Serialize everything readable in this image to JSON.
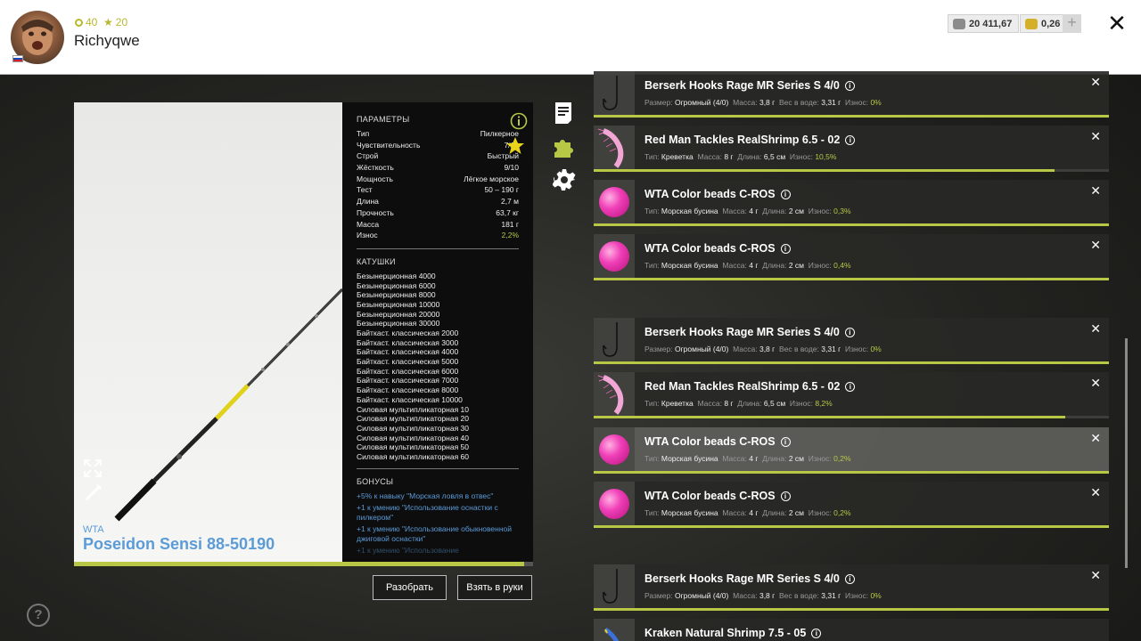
{
  "player": {
    "name": "Richyqwe",
    "level": "40",
    "rank": "20"
  },
  "currency": {
    "silver": "20 411,67",
    "gold": "0,26",
    "add": "+"
  },
  "close": "✕",
  "rod": {
    "brand": "WTA",
    "name": "Poseidon Sensi 88-50190",
    "wear_fraction": 0.98
  },
  "params": {
    "title": "ПАРАМЕТРЫ",
    "rows": [
      {
        "label": "Тип",
        "value": "Пилкерное"
      },
      {
        "label": "Чувствительность",
        "value": "7/10"
      },
      {
        "label": "Строй",
        "value": "Быстрый"
      },
      {
        "label": "Жёсткость",
        "value": "9/10"
      },
      {
        "label": "Мощность",
        "value": "Лёгкое морское"
      },
      {
        "label": "Тест",
        "value": "50 – 190 г"
      },
      {
        "label": "Длина",
        "value": "2,7 м"
      },
      {
        "label": "Прочность",
        "value": "63,7 кг"
      },
      {
        "label": "Масса",
        "value": "181 г"
      },
      {
        "label": "Износ",
        "value": "2,2%"
      }
    ],
    "reels_title": "КАТУШКИ",
    "reels": [
      "Безынерционная 4000",
      "Безынерционная 6000",
      "Безынерционная 8000",
      "Безынерционная 10000",
      "Безынерционная 20000",
      "Безынерционная 30000",
      "Байткаст. классическая 2000",
      "Байткаст. классическая 3000",
      "Байткаст. классическая 4000",
      "Байткаст. классическая 5000",
      "Байткаст. классическая 6000",
      "Байткаст. классическая 7000",
      "Байткаст. классическая 8000",
      "Байткаст. классическая 10000",
      "Силовая мультипликаторная 10",
      "Силовая мультипликаторная 20",
      "Силовая мультипликаторная 30",
      "Силовая мультипликаторная 40",
      "Силовая мультипликаторная 50",
      "Силовая мультипликаторная 60"
    ],
    "bonus_title": "БОНУСЫ",
    "bonuses": [
      "+5% к навыку \"Морская ловля в отвес\"",
      "+1 к умению \"Использование оснастки с пилкером\"",
      "+1 к умению \"Использование обыкновенной джиговой оснастки\"",
      "+1 к умению \"Использование"
    ]
  },
  "buttons": {
    "disassemble": "Разобрать",
    "take": "Взять в руки"
  },
  "labels": {
    "size": "Размер:",
    "mass": "Масса:",
    "weight_water": "Вес в воде:",
    "wear": "Износ:",
    "type": "Тип:",
    "length": "Длина:"
  },
  "items": [
    {
      "kind": "hook",
      "title": "Berserk Hooks Rage MR Series S 4/0",
      "size": "Огромный (4/0)",
      "mass": "3,8 г",
      "weight_water": "3,31 г",
      "wear": "0%",
      "bar": 1.0
    },
    {
      "kind": "shrimp",
      "title": "Red Man Tackles RealShrimp 6.5 - 02",
      "type": "Креветка",
      "mass": "8 г",
      "length": "6,5 см",
      "wear": "10,5%",
      "bar": 0.895
    },
    {
      "kind": "bead",
      "title": "WTA Color beads C-ROS",
      "type": "Морская бусина",
      "mass": "4 г",
      "length": "2 см",
      "wear": "0,3%",
      "bar": 1.0
    },
    {
      "kind": "bead",
      "title": "WTA Color beads C-ROS",
      "type": "Морская бусина",
      "mass": "4 г",
      "length": "2 см",
      "wear": "0,4%",
      "bar": 1.0
    },
    {
      "kind": "hook",
      "title": "Berserk Hooks Rage MR Series S 4/0",
      "size": "Огромный (4/0)",
      "mass": "3,8 г",
      "weight_water": "3,31 г",
      "wear": "0%",
      "bar": 1.0
    },
    {
      "kind": "shrimp",
      "title": "Red Man Tackles RealShrimp 6.5 - 02",
      "type": "Креветка",
      "mass": "8 г",
      "length": "6,5 см",
      "wear": "8,2%",
      "bar": 0.915
    },
    {
      "kind": "bead",
      "title": "WTA Color beads C-ROS",
      "type": "Морская бусина",
      "mass": "4 г",
      "length": "2 см",
      "wear": "0,2%",
      "bar": 1.0,
      "selected": true
    },
    {
      "kind": "bead",
      "title": "WTA Color beads C-ROS",
      "type": "Морская бусина",
      "mass": "4 г",
      "length": "2 см",
      "wear": "0,2%",
      "bar": 1.0
    },
    {
      "kind": "hook",
      "title": "Berserk Hooks Rage MR Series S 4/0",
      "size": "Огромный (4/0)",
      "mass": "3,8 г",
      "weight_water": "3,31 г",
      "wear": "0%",
      "bar": 1.0
    },
    {
      "kind": "shrimp-blue",
      "title": "Kraken Natural Shrimp 7.5 - 05"
    }
  ],
  "colors": {
    "accent": "#b8c846",
    "link": "#5b9bd8",
    "gold": "#d4b02a"
  }
}
